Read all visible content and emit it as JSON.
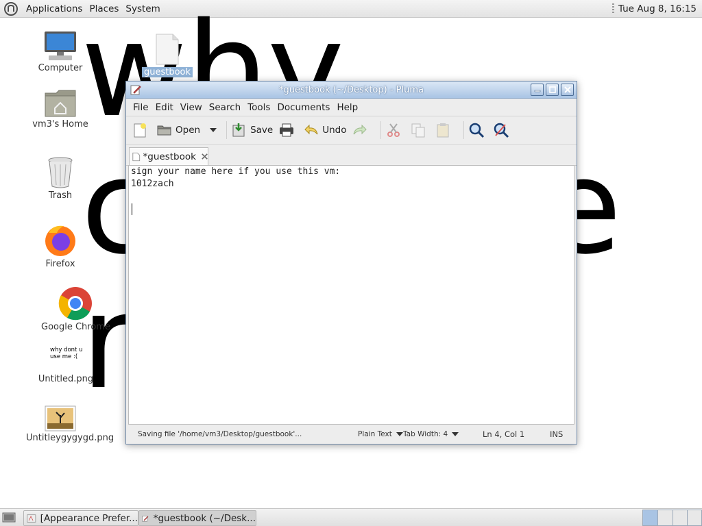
{
  "top_panel": {
    "menus": [
      "Applications",
      "Places",
      "System"
    ],
    "clock": "Tue Aug  8, 16:15"
  },
  "desktop": {
    "wallpaper_words": [
      "why",
      "c",
      "r",
      "e"
    ],
    "icons": [
      {
        "label": "Computer",
        "icon": "computer-icon"
      },
      {
        "label": "guestbook",
        "icon": "text-file-icon"
      },
      {
        "label": "vm3's Home",
        "icon": "home-folder-icon"
      },
      {
        "label": "Trash",
        "icon": "trash-icon"
      },
      {
        "label": "Firefox",
        "icon": "firefox-icon"
      },
      {
        "label": "Google Chrome",
        "icon": "chrome-icon"
      },
      {
        "label": "Untitled.png",
        "icon": "image-thumbnail-icon",
        "thumb_text": "why dont u use me :("
      },
      {
        "label": "Untitleygygygd.png",
        "icon": "image-thumbnail-icon"
      }
    ]
  },
  "window": {
    "title": "*guestbook (~/Desktop) - Pluma",
    "menu": [
      "File",
      "Edit",
      "View",
      "Search",
      "Tools",
      "Documents",
      "Help"
    ],
    "toolbar": {
      "open": "Open",
      "save": "Save",
      "undo": "Undo"
    },
    "tab_label": "*guestbook",
    "editor_lines": [
      "sign your name here if you use this vm:",
      "1012zach",
      ""
    ],
    "status": {
      "message": "Saving file '/home/vm3/Desktop/guestbook'...",
      "language": "Plain Text",
      "tab_width": "Tab Width:  4",
      "position": "Ln 4, Col 1",
      "mode": "INS"
    }
  },
  "taskbar": {
    "tasks": [
      "[Appearance Prefer...",
      "*guestbook (~/Desk..."
    ]
  },
  "colors": {
    "titlebar": "#a9c4e4",
    "selection": "#8fb2d7",
    "panel": "#e3e3e3"
  }
}
